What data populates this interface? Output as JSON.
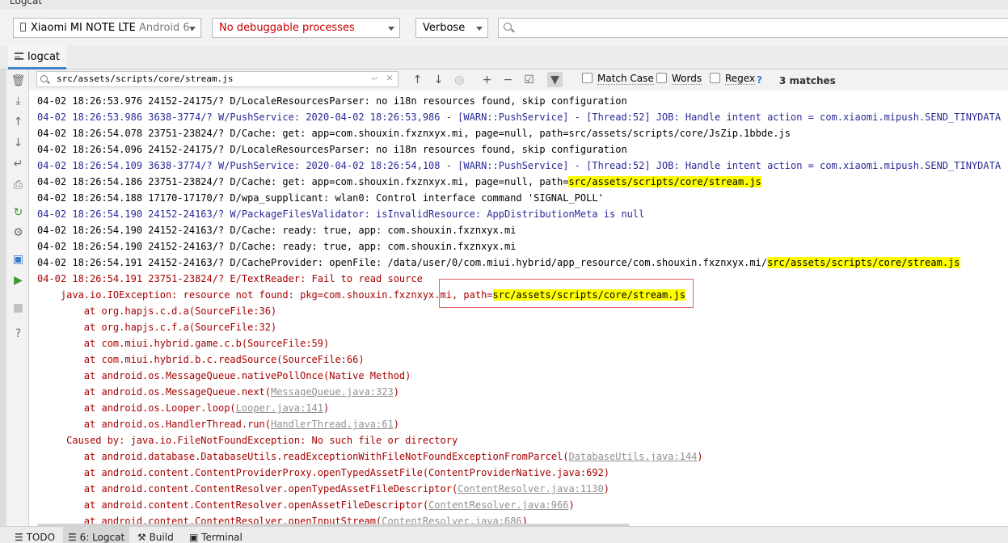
{
  "window": {
    "title": "Logcat"
  },
  "toolbar": {
    "device_name": "Xiaomi MI NOTE LTE",
    "device_os": "Android 6.",
    "process": "No debuggable processes",
    "log_level": "Verbose",
    "search_value": ""
  },
  "tabs": {
    "logcat": "logcat"
  },
  "find_bar": {
    "query": "src/assets/scripts/core/stream.js",
    "match_case": "Match Case",
    "words": "Words",
    "regex": "Regex",
    "help": "?",
    "matches": "3 matches"
  },
  "log": {
    "lines": [
      {
        "level": "d",
        "text": "04-02 18:26:53.976 24152-24175/? D/LocaleResourcesParser: no i18n resources found, skip configuration"
      },
      {
        "level": "w",
        "text": "04-02 18:26:53.986 3638-3774/? W/PushService: 2020-04-02 18:26:53,986 - [WARN::PushService] - [Thread:52] JOB: Handle intent action = com.xiaomi.mipush.SEND_TINYDATA"
      },
      {
        "level": "d",
        "text": "04-02 18:26:54.078 23751-23824/? D/Cache: get: app=com.shouxin.fxznxyx.mi, page=null, path=src/assets/scripts/core/JsZip.1bbde.js"
      },
      {
        "level": "d",
        "text": "04-02 18:26:54.096 24152-24175/? D/LocaleResourcesParser: no i18n resources found, skip configuration"
      },
      {
        "level": "w",
        "text": "04-02 18:26:54.109 3638-3774/? W/PushService: 2020-04-02 18:26:54,108 - [WARN::PushService] - [Thread:52] JOB: Handle intent action = com.xiaomi.mipush.SEND_TINYDATA"
      },
      {
        "level": "d",
        "text": "04-02 18:26:54.186 23751-23824/? D/Cache: get: app=com.shouxin.fxznxyx.mi, page=null, path=",
        "highlight": "src/assets/scripts/core/stream.js"
      },
      {
        "level": "d",
        "text": "04-02 18:26:54.188 17170-17170/? D/wpa_supplicant: wlan0: Control interface command 'SIGNAL_POLL'"
      },
      {
        "level": "w",
        "text": "04-02 18:26:54.190 24152-24163/? W/PackageFilesValidator: isInvalidResource: AppDistributionMeta is null"
      },
      {
        "level": "d",
        "text": "04-02 18:26:54.190 24152-24163/? D/Cache: ready: true, app: com.shouxin.fxznxyx.mi"
      },
      {
        "level": "d",
        "text": "04-02 18:26:54.190 24152-24163/? D/Cache: ready: true, app: com.shouxin.fxznxyx.mi"
      },
      {
        "level": "d",
        "text": "04-02 18:26:54.191 24152-24163/? D/CacheProvider: openFile: /data/user/0/com.miui.hybrid/app_resource/com.shouxin.fxznxyx.mi/",
        "highlight": "src/assets/scripts/core/stream.js"
      },
      {
        "level": "e",
        "text": "04-02 18:26:54.191 23751-23824/? E/TextReader: Fail to read source"
      },
      {
        "level": "e",
        "text": "    java.io.IOException: resource not found: pkg=com.shouxin.fxznxyx.mi, path=",
        "highlight": "src/assets/scripts/core/stream.js"
      },
      {
        "level": "e",
        "text": "        at org.hapjs.c.d.a(SourceFile:36)"
      },
      {
        "level": "e",
        "text": "        at org.hapjs.c.f.a(SourceFile:32)"
      },
      {
        "level": "e",
        "text": "        at com.miui.hybrid.game.c.b(SourceFile:59)"
      },
      {
        "level": "e",
        "text": "        at com.miui.hybrid.b.c.readSource(SourceFile:66)"
      },
      {
        "level": "e",
        "text": "        at android.os.MessageQueue.nativePollOnce(Native Method)"
      },
      {
        "level": "e",
        "text": "        at android.os.MessageQueue.next(",
        "link": "MessageQueue.java:323",
        "after": ")"
      },
      {
        "level": "e",
        "text": "        at android.os.Looper.loop(",
        "link": "Looper.java:141",
        "after": ")"
      },
      {
        "level": "e",
        "text": "        at android.os.HandlerThread.run(",
        "link": "HandlerThread.java:61",
        "after": ")"
      },
      {
        "level": "e",
        "text": "     Caused by: java.io.FileNotFoundException: No such file or directory"
      },
      {
        "level": "e",
        "text": "        at android.database.DatabaseUtils.readExceptionWithFileNotFoundExceptionFromParcel(",
        "link": "DatabaseUtils.java:144",
        "after": ")"
      },
      {
        "level": "e",
        "text": "        at android.content.ContentProviderProxy.openTypedAssetFile(ContentProviderNative.java:692)"
      },
      {
        "level": "e",
        "text": "        at android.content.ContentResolver.openTypedAssetFileDescriptor(",
        "link": "ContentResolver.java:1130",
        "after": ")"
      },
      {
        "level": "e",
        "text": "        at android.content.ContentResolver.openAssetFileDescriptor(",
        "link": "ContentResolver.java:966",
        "after": ")"
      },
      {
        "level": "e",
        "text": "        at android.content.ContentResolver.openInputStream(",
        "link": "ContentResolver.java:686",
        "after": ")"
      }
    ]
  },
  "bottom_tabs": [
    {
      "label": "TODO",
      "active": false
    },
    {
      "label": "6: Logcat",
      "active": true
    },
    {
      "label": "Build",
      "active": false
    },
    {
      "label": "Terminal",
      "active": false
    }
  ],
  "colors": {
    "debug": "#000000",
    "warn": "#2a2a9a",
    "error": "#a80000",
    "highlight": "#ffff00",
    "error_process": "#c90000"
  }
}
